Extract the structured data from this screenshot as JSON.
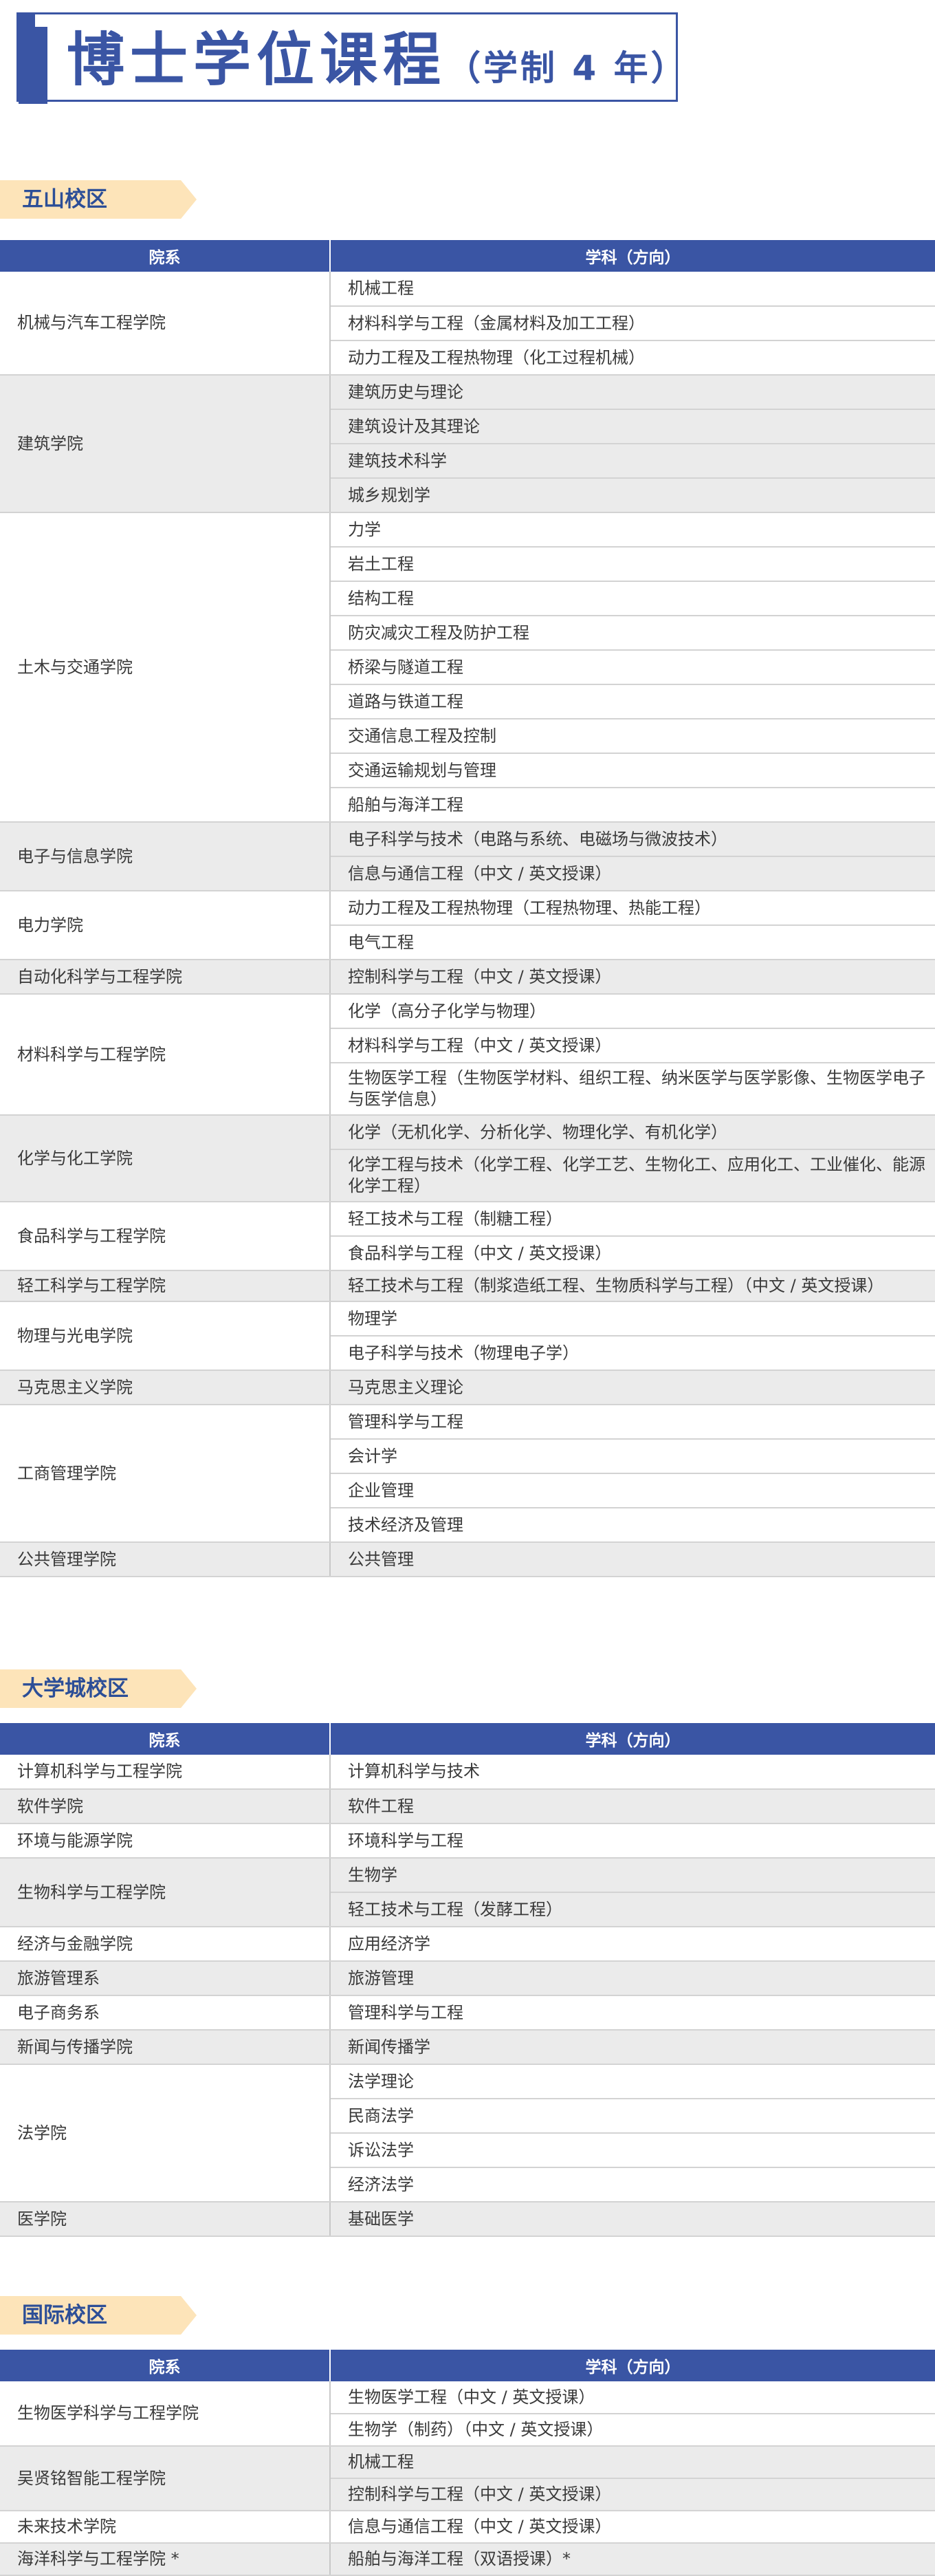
{
  "title": {
    "main": "博士学位课程",
    "sub": "（学制 4 年）"
  },
  "header": {
    "col1": "院系",
    "col2": "学科（方向）"
  },
  "campuses": [
    {
      "name": "五山校区",
      "groups": [
        {
          "dept": "机械与汽车工程学院",
          "subjects": [
            "机械工程",
            "材料科学与工程（金属材料及加工工程）",
            "动力工程及工程热物理（化工过程机械）"
          ]
        },
        {
          "dept": "建筑学院",
          "subjects": [
            "建筑历史与理论",
            "建筑设计及其理论",
            "建筑技术科学",
            "城乡规划学"
          ]
        },
        {
          "dept": "土木与交通学院",
          "subjects": [
            "力学",
            "岩土工程",
            "结构工程",
            "防灾减灾工程及防护工程",
            "桥梁与隧道工程",
            "道路与铁道工程",
            "交通信息工程及控制",
            "交通运输规划与管理",
            "船舶与海洋工程"
          ]
        },
        {
          "dept": "电子与信息学院",
          "subjects": [
            "电子科学与技术（电路与系统、电磁场与微波技术）",
            "信息与通信工程（中文 / 英文授课）"
          ]
        },
        {
          "dept": "电力学院",
          "subjects": [
            "动力工程及工程热物理（工程热物理、热能工程）",
            "电气工程"
          ]
        },
        {
          "dept": "自动化科学与工程学院",
          "subjects": [
            "控制科学与工程（中文 / 英文授课）"
          ]
        },
        {
          "dept": "材料科学与工程学院",
          "subjects": [
            "化学（高分子化学与物理）",
            "材料科学与工程（中文 / 英文授课）",
            "生物医学工程（生物医学材料、组织工程、纳米医学与医学影像、生物医学电子与医学信息）"
          ]
        },
        {
          "dept": "化学与化工学院",
          "subjects": [
            "化学（无机化学、分析化学、物理化学、有机化学）",
            "化学工程与技术（化学工程、化学工艺、生物化工、应用化工、工业催化、能源化学工程）"
          ]
        },
        {
          "dept": "食品科学与工程学院",
          "subjects": [
            "轻工技术与工程（制糖工程）",
            "食品科学与工程（中文 / 英文授课）"
          ]
        },
        {
          "dept": "轻工科学与工程学院",
          "subjects": [
            "轻工技术与工程（制浆造纸工程、生物质科学与工程）（中文 / 英文授课）"
          ]
        },
        {
          "dept": "物理与光电学院",
          "subjects": [
            "物理学",
            "电子科学与技术（物理电子学）"
          ]
        },
        {
          "dept": "马克思主义学院",
          "subjects": [
            "马克思主义理论"
          ]
        },
        {
          "dept": "工商管理学院",
          "subjects": [
            "管理科学与工程",
            "会计学",
            "企业管理",
            "技术经济及管理"
          ]
        },
        {
          "dept": "公共管理学院",
          "subjects": [
            "公共管理"
          ]
        }
      ]
    },
    {
      "name": "大学城校区",
      "groups": [
        {
          "dept": "计算机科学与工程学院",
          "subjects": [
            "计算机科学与技术"
          ]
        },
        {
          "dept": "软件学院",
          "subjects": [
            "软件工程"
          ]
        },
        {
          "dept": "环境与能源学院",
          "subjects": [
            "环境科学与工程"
          ]
        },
        {
          "dept": "生物科学与工程学院",
          "subjects": [
            "生物学",
            "轻工技术与工程（发酵工程）"
          ]
        },
        {
          "dept": "经济与金融学院",
          "subjects": [
            "应用经济学"
          ]
        },
        {
          "dept": "旅游管理系",
          "subjects": [
            "旅游管理"
          ]
        },
        {
          "dept": "电子商务系",
          "subjects": [
            "管理科学与工程"
          ]
        },
        {
          "dept": "新闻与传播学院",
          "subjects": [
            "新闻传播学"
          ]
        },
        {
          "dept": "法学院",
          "subjects": [
            "法学理论",
            "民商法学",
            "诉讼法学",
            "经济法学"
          ]
        },
        {
          "dept": "医学院",
          "subjects": [
            "基础医学"
          ]
        }
      ]
    },
    {
      "name": "国际校区",
      "groups": [
        {
          "dept": "生物医学科学与工程学院",
          "subjects": [
            "生物医学工程（中文 / 英文授课）",
            "生物学（制药）（中文 / 英文授课）"
          ]
        },
        {
          "dept": "吴贤铭智能工程学院",
          "subjects": [
            "机械工程",
            "控制科学与工程（中文 / 英文授课）"
          ]
        },
        {
          "dept": "未来技术学院",
          "subjects": [
            "信息与通信工程（中文 / 英文授课）"
          ]
        },
        {
          "dept": "海洋科学与工程学院 *",
          "subjects": [
            "船舶与海洋工程（双语授课）*"
          ]
        }
      ]
    }
  ]
}
